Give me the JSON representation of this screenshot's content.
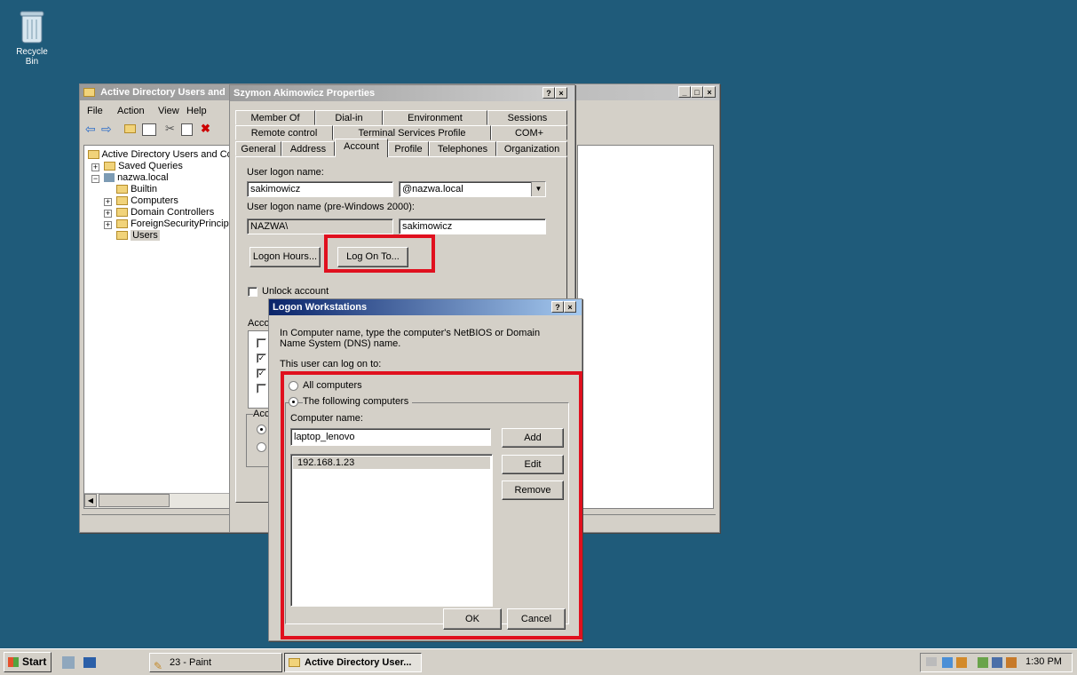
{
  "desktop": {
    "recycle_bin_label": "Recycle Bin"
  },
  "aduc": {
    "title": "Active Directory Users and",
    "menu": [
      "File",
      "Action",
      "View",
      "Help"
    ],
    "tree": {
      "root": "Active Directory Users and Cor",
      "saved_queries": "Saved Queries",
      "domain": "nazwa.local",
      "children": [
        "Builtin",
        "Computers",
        "Domain Controllers",
        "ForeignSecurityPrincipa",
        "Users"
      ]
    }
  },
  "props": {
    "title": "Szymon Akimowicz Properties",
    "tabs_row1": [
      "Member Of",
      "Dial-in",
      "Environment",
      "Sessions"
    ],
    "tabs_row2": [
      "Remote control",
      "Terminal Services Profile",
      "COM+"
    ],
    "tabs_row3": [
      "General",
      "Address",
      "Account",
      "Profile",
      "Telephones",
      "Organization"
    ],
    "logon_name_label": "User logon name:",
    "logon_name_value": "sakimowicz",
    "domain_value": "@nazwa.local",
    "pre2000_label": "User logon name (pre-Windows 2000):",
    "pre2000_domain": "NAZWA\\",
    "pre2000_value": "sakimowicz",
    "logon_hours_button": "Logon Hours...",
    "log_on_to_button": "Log On To...",
    "unlock_label": "Unlock account",
    "account_options_partial": "Acco",
    "account_expires_partial": "Acc"
  },
  "workstations": {
    "title": "Logon Workstations",
    "help_glyph": "?",
    "close_glyph": "×",
    "description": "In Computer name, type the computer's NetBIOS or Domain Name System (DNS) name.",
    "user_can_log_on_label": "This user can log on to:",
    "all_computers_label": "All computers",
    "following_computers_label": "The following computers",
    "computer_name_label": "Computer name:",
    "computer_name_value": "laptop_lenovo",
    "list_items": [
      "192.168.1.23"
    ],
    "add_button": "Add",
    "edit_button": "Edit",
    "remove_button": "Remove",
    "ok_button": "OK",
    "cancel_button": "Cancel"
  },
  "taskbar": {
    "start_label": "Start",
    "tasks": [
      "23 - Paint",
      "Active Directory User..."
    ],
    "clock": "1:30 PM"
  },
  "colors": {
    "desktop": "#1f5b7a",
    "highlight": "#e0101e",
    "window": "#d4d0c8"
  }
}
